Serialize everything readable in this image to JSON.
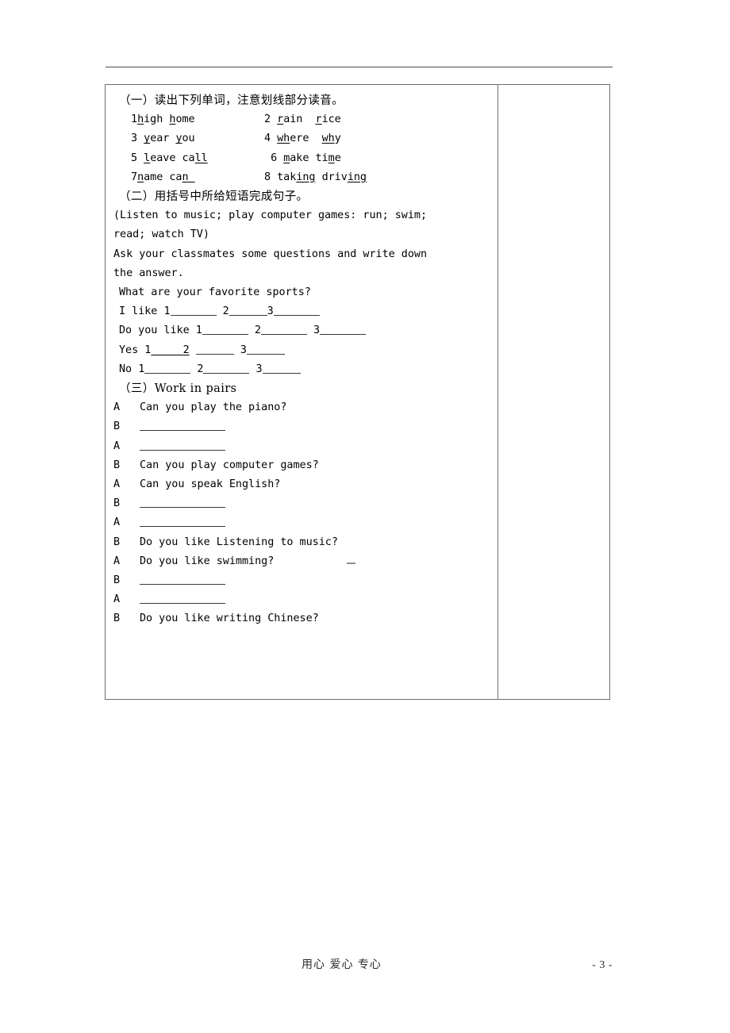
{
  "document": {
    "footer": {
      "motto": "用心  爱心  专心",
      "page_number": "- 3 -"
    }
  },
  "section_one": {
    "heading": "（一）读出下列单词，注意划线部分读音。",
    "word_rows": [
      {
        "left": {
          "num": "1",
          "w1_pre": "",
          "w1_u": "h",
          "w1_post": "igh",
          "w2_pre": "",
          "w2_u": "h",
          "w2_post": "ome"
        },
        "right": {
          "num": "2",
          "w1_pre": "",
          "w1_u": "r",
          "w1_post": "ain",
          "w2_pre": "",
          "w2_u": "r",
          "w2_post": "ice"
        }
      },
      {
        "left": {
          "num": "3",
          "w1_pre": "",
          "w1_u": "y",
          "w1_post": "ear",
          "w2_pre": "",
          "w2_u": "y",
          "w2_post": "ou"
        },
        "right": {
          "num": "4",
          "w1_pre": "",
          "w1_u": "wh",
          "w1_post": "ere",
          "w2_pre": "",
          "w2_u": "wh",
          "w2_post": "y"
        }
      },
      {
        "left": {
          "num": "5",
          "w1_pre": "",
          "w1_u": "l",
          "w1_post": "eave",
          "w2_pre": "ca",
          "w2_u": "ll",
          "w2_post": ""
        },
        "right": {
          "num": "6",
          "w1_pre": "",
          "w1_u": "m",
          "w1_post": "ake",
          "w2_pre": "ti",
          "w2_u": "m",
          "w2_post": "e"
        }
      },
      {
        "left": {
          "num": "7",
          "w1_pre": "",
          "w1_u": "n",
          "w1_post": "ame",
          "w2_pre": "ca",
          "w2_u": "n",
          "w2_post": ""
        },
        "right": {
          "num": "8",
          "w1_pre": "tak",
          "w1_u": "ing",
          "w1_post": "",
          "w2_pre": "driv",
          "w2_u": "ing",
          "w2_post": ""
        }
      }
    ]
  },
  "section_two": {
    "heading": "（二）用括号中所给短语完成句子。",
    "word_bank_line1": "(Listen to music; play computer games: run; swim;",
    "word_bank_line2": "read; watch TV)",
    "instruction_line1": "Ask your classmates some questions and write down",
    "instruction_line2": "the answer.",
    "question": "What are your favorite sports?",
    "answers": {
      "i_like_label": "I like ",
      "do_you_like_label": "Do you like ",
      "yes_label": "Yes ",
      "no_label": "No ",
      "n1": "1",
      "n2": "2",
      "n3": "3"
    }
  },
  "section_three": {
    "heading": "（三）Work in pairs",
    "dialogue": [
      {
        "speaker": "A",
        "text": "Can you play the piano?",
        "blank": false
      },
      {
        "speaker": "B",
        "text": "",
        "blank": true
      },
      {
        "speaker": "A",
        "text": "",
        "blank": true
      },
      {
        "speaker": "B",
        "text": "Can you play computer games?",
        "blank": false
      },
      {
        "speaker": "A",
        "text": "Can you speak English?",
        "blank": false
      },
      {
        "speaker": "B",
        "text": "",
        "blank": true
      },
      {
        "speaker": "A",
        "text": "",
        "blank": true
      },
      {
        "speaker": "B",
        "text": "Do you like Listening to music?",
        "blank": false
      },
      {
        "speaker": "A",
        "text": "Do you like swimming?",
        "blank": false
      },
      {
        "speaker": "B",
        "text": "",
        "blank": true
      },
      {
        "speaker": "A",
        "text": "",
        "blank": true
      },
      {
        "speaker": "B",
        "text": "Do you like writing Chinese?",
        "blank": false
      }
    ]
  }
}
